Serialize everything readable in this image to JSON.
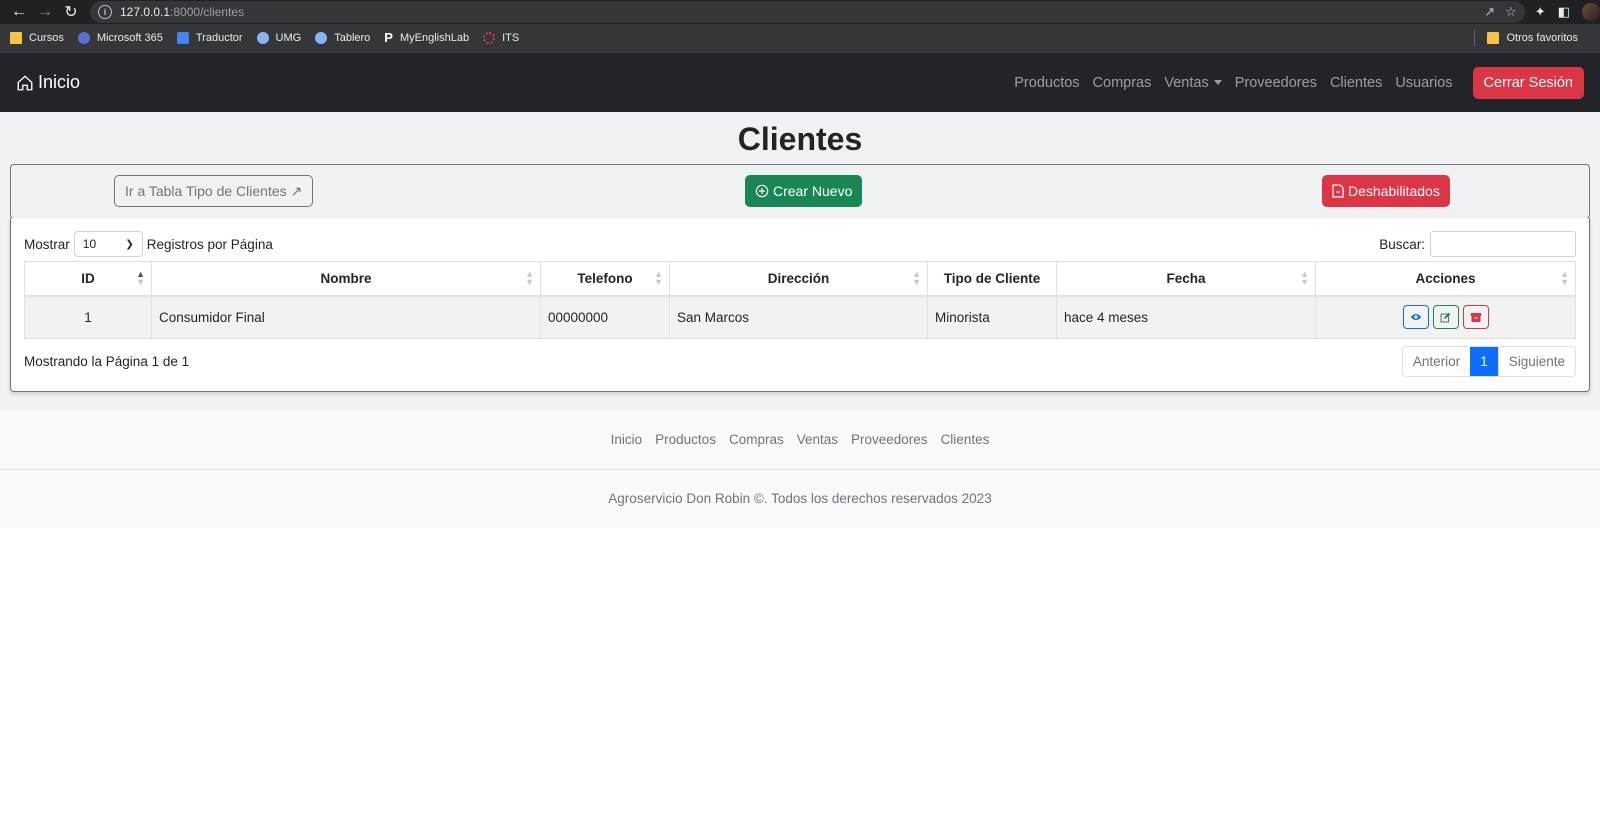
{
  "browser": {
    "url_host": "127.0.0.1",
    "url_path": ":8000/clientes",
    "bookmarks": [
      {
        "label": "Cursos",
        "icon": "folder-icon",
        "color": "#f6c342"
      },
      {
        "label": "Microsoft 365",
        "icon": "microsoft365-icon",
        "color": "#5b6dd8"
      },
      {
        "label": "Traductor",
        "icon": "translate-icon",
        "color": "#4285f4"
      },
      {
        "label": "UMG",
        "icon": "umg-icon",
        "color": "#8ab4f8"
      },
      {
        "label": "Tablero",
        "icon": "tablero-icon",
        "color": "#8ab4f8"
      },
      {
        "label": "MyEnglishLab",
        "icon": "myenglishlab-icon",
        "color": "#ffffff"
      },
      {
        "label": "ITS",
        "icon": "its-icon",
        "color": "#e53935"
      }
    ],
    "other_bookmarks": "Otros favoritos"
  },
  "navbar": {
    "brand": "Inicio",
    "links": [
      "Productos",
      "Compras",
      "Ventas",
      "Proveedores",
      "Clientes",
      "Usuarios"
    ],
    "logout": "Cerrar Sesión"
  },
  "page": {
    "title": "Clientes",
    "btn_tipo": "Ir a Tabla Tipo de Clientes",
    "btn_crear": "Crear Nuevo",
    "btn_deshabilitados": "Deshabilitados"
  },
  "table": {
    "show_label": "Mostrar",
    "page_size": "10",
    "per_page_label": "Registros por Página",
    "search_label": "Buscar:",
    "columns": [
      "ID",
      "Nombre",
      "Telefono",
      "Dirección",
      "Tipo de Cliente",
      "Fecha",
      "Acciones"
    ],
    "rows": [
      {
        "id": "1",
        "nombre": "Consumidor Final",
        "telefono": "00000000",
        "direccion": "San Marcos",
        "tipo": "Minorista",
        "fecha": "hace 4 meses"
      }
    ],
    "info": "Mostrando la Página 1 de 1",
    "prev": "Anterior",
    "current_page": "1",
    "next": "Siguiente"
  },
  "footer": {
    "links": [
      "Inicio",
      "Productos",
      "Compras",
      "Ventas",
      "Proveedores",
      "Clientes"
    ],
    "copyright": "Agroservicio Don Robin ©. Todos los derechos reservados 2023"
  },
  "colors": {
    "navbar": "#212529",
    "success": "#198754",
    "danger": "#dc3545",
    "primary": "#0d6efd"
  }
}
